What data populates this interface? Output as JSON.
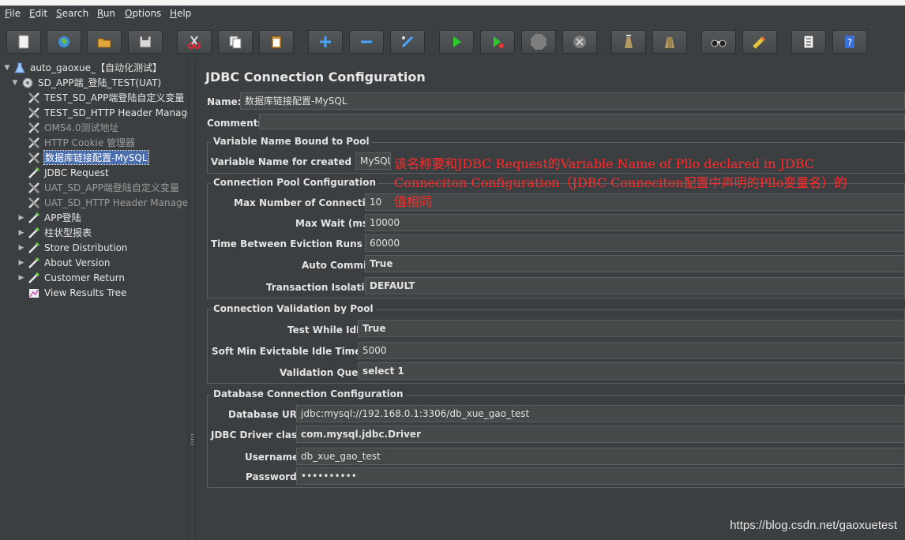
{
  "menu": [
    {
      "label": "File",
      "underline": "F",
      "rest": "ile"
    },
    {
      "label": "Edit",
      "underline": "E",
      "rest": "dit"
    },
    {
      "label": "Search",
      "underline": "S",
      "rest": "earch"
    },
    {
      "label": "Run",
      "underline": "R",
      "rest": "un"
    },
    {
      "label": "Options",
      "underline": "O",
      "rest": "ptions"
    },
    {
      "label": "Help",
      "underline": "H",
      "rest": "elp"
    }
  ],
  "toolbar": {
    "icons": [
      "new-icon",
      "templates-icon",
      "open-icon",
      "save-icon",
      "cut-icon",
      "copy-icon",
      "paste-icon",
      "expand-icon",
      "collapse-icon",
      "toggle-icon",
      "start-icon",
      "start-no-pauses-icon",
      "stop-icon",
      "shutdown-icon",
      "clear-icon",
      "clear-all-icon",
      "search-icon",
      "reset-search-icon",
      "function-helper-icon",
      "help-icon"
    ]
  },
  "tree": {
    "items": [
      {
        "label": "auto_gaoxue_【自动化测试】",
        "icon": "test-plan-icon",
        "depth": 0,
        "expander": "▼"
      },
      {
        "label": "SD_APP端_登陆_TEST(UAT)",
        "icon": "thread-group-icon",
        "depth": 1,
        "expander": "▼"
      },
      {
        "label": "TEST_SD_APP端登陆自定义变量",
        "icon": "config-element-icon",
        "depth": 2,
        "expander": ""
      },
      {
        "label": "TEST_SD_HTTP Header Manage",
        "icon": "config-element-icon",
        "depth": 2,
        "expander": ""
      },
      {
        "label": "OMS4.0测试地址",
        "icon": "config-element-icon",
        "depth": 2,
        "expander": "",
        "dim": true
      },
      {
        "label": "HTTP Cookie 管理器",
        "icon": "config-element-icon",
        "depth": 2,
        "expander": "",
        "dim": true
      },
      {
        "label": "数据库链接配置-MySQL",
        "icon": "config-element-icon",
        "depth": 2,
        "expander": "",
        "selected": true
      },
      {
        "label": "JDBC Request",
        "icon": "sampler-icon",
        "depth": 2,
        "expander": ""
      },
      {
        "label": "UAT_SD_APP端登陆自定义变量",
        "icon": "config-element-icon",
        "depth": 2,
        "expander": "",
        "dim": true
      },
      {
        "label": "UAT_SD_HTTP Header Manager",
        "icon": "config-element-icon",
        "depth": 2,
        "expander": "",
        "dim": true
      },
      {
        "label": "APP登陆",
        "icon": "sampler-icon",
        "depth": 2,
        "expander": "▶"
      },
      {
        "label": "柱状型报表",
        "icon": "sampler-icon",
        "depth": 2,
        "expander": "▶"
      },
      {
        "label": "Store Distribution",
        "icon": "sampler-icon",
        "depth": 2,
        "expander": "▶"
      },
      {
        "label": "About Version",
        "icon": "sampler-icon",
        "depth": 2,
        "expander": "▶"
      },
      {
        "label": "Customer Return",
        "icon": "sampler-icon",
        "depth": 2,
        "expander": "▶"
      },
      {
        "label": "View Results Tree",
        "icon": "listener-icon",
        "depth": 2,
        "expander": ""
      }
    ]
  },
  "panel": {
    "title": "JDBC Connection Configuration",
    "name_label": "Name:",
    "name_value": "数据库链接配置-MySQL",
    "comments_label": "Comments:",
    "comments_value": "",
    "pool_var": {
      "group_title": "Variable Name Bound to Pool",
      "label": "Variable Name for created pool:",
      "value": "MySQL"
    },
    "pool_cfg": {
      "group_title": "Connection Pool Configuration",
      "max_conn_label": "Max Number of Connections:",
      "max_conn_value": "10",
      "max_wait_label": "Max Wait (ms):",
      "max_wait_value": "10000",
      "eviction_label": "Time Between Eviction Runs (ms):",
      "eviction_value": "60000",
      "auto_commit_label": "Auto Commit:",
      "auto_commit_value": "True",
      "isolation_label": "Transaction Isolation:",
      "isolation_value": "DEFAULT"
    },
    "validation": {
      "group_title": "Connection Validation by Pool",
      "test_idle_label": "Test While Idle:",
      "test_idle_value": "True",
      "soft_min_label": "Soft Min Evictable Idle Time(ms):",
      "soft_min_value": "5000",
      "query_label": "Validation Query:",
      "query_value": "select 1"
    },
    "db": {
      "group_title": "Database Connection Configuration",
      "url_label": "Database URL:",
      "url_value": "jdbc:mysql://192.168.0.1:3306/db_xue_gao_test",
      "driver_label": "JDBC Driver class:",
      "driver_value": "com.mysql.jdbc.Driver",
      "user_label": "Username:",
      "user_value": "db_xue_gao_test",
      "pass_label": "Password:",
      "pass_value": "••••••••••"
    }
  },
  "annotation": {
    "line1": "该名称要和JDBC Request的Variable Name of Pllo declared in JDBC",
    "line2": "Conneciton Configuration（JDBC Conneciton配置中声明的Pllo变量名）的",
    "line3": "值相同",
    "color": "#ff2a2a"
  },
  "watermark": "https://blog.csdn.net/gaoxuetest"
}
